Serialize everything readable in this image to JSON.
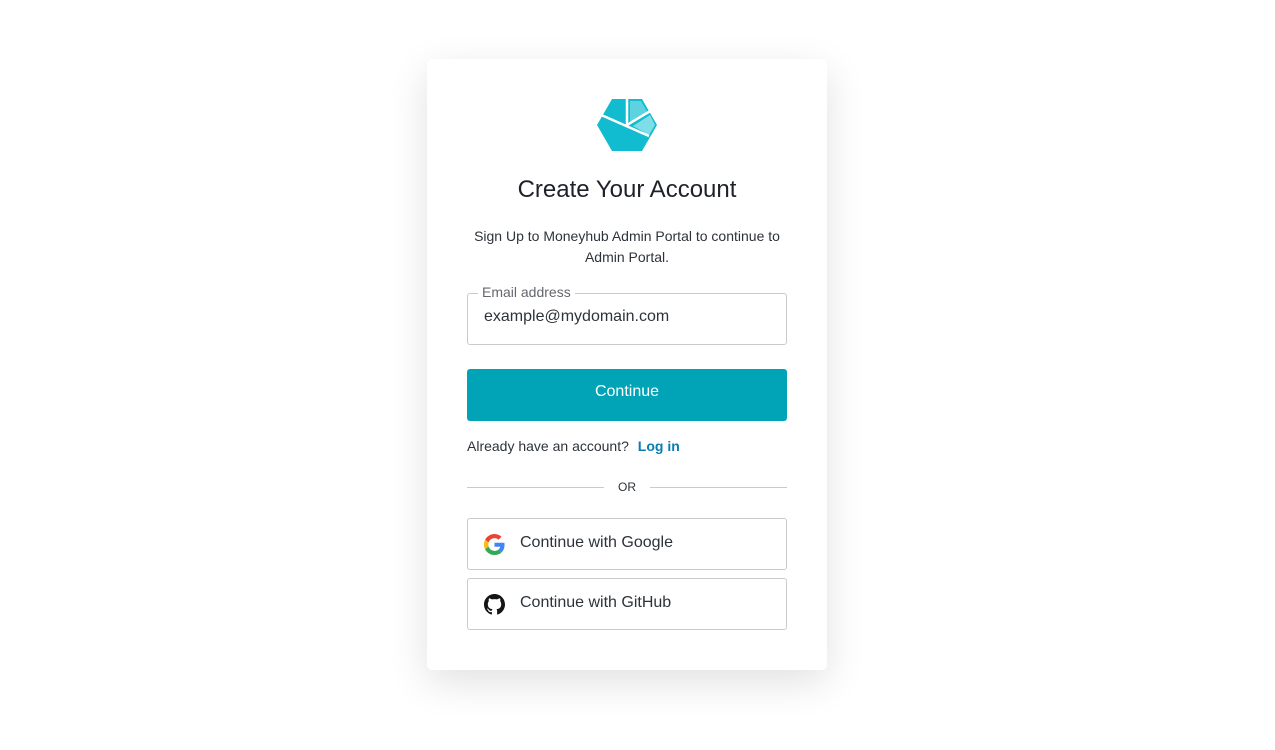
{
  "header": {
    "logo_icon": "moneyhub-hexagon-logo",
    "title": "Create Your Account",
    "subtitle": "Sign Up to Moneyhub Admin Portal to continue to Admin Portal."
  },
  "form": {
    "email_label": "Email address",
    "email_value": "example@mydomain.com",
    "continue_label": "Continue"
  },
  "login": {
    "prompt": "Already have an account?",
    "link_label": "Log in"
  },
  "divider": {
    "label": "OR"
  },
  "social": [
    {
      "label": "Continue with Google",
      "icon": "google-icon"
    },
    {
      "label": "Continue with GitHub",
      "icon": "github-icon"
    }
  ],
  "colors": {
    "accent": "#00a4b6",
    "link": "#0a7cb5",
    "logo_primary": "#11bcd0",
    "logo_light": "#6fd6e3"
  }
}
